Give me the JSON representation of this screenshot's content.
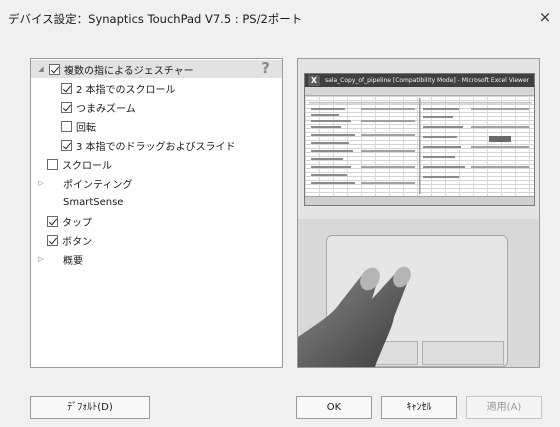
{
  "window": {
    "title": "デバイス設定：Synaptics TouchPad V7.5 : PS/2ポート",
    "close_glyph": "×"
  },
  "settings": {
    "help_glyph": "?",
    "items": [
      {
        "label": "複数の指によるジェスチャー",
        "checked": true
      },
      {
        "label": "2 本指でのスクロール",
        "checked": true
      },
      {
        "label": "つまみズーム",
        "checked": true
      },
      {
        "label": "回転",
        "checked": false
      },
      {
        "label": "3 本指でのドラッグおよびスライド",
        "checked": true
      },
      {
        "label": "スクロール",
        "checked": false
      },
      {
        "label": "ポインティング"
      },
      {
        "label": "SmartSense"
      },
      {
        "label": "タップ",
        "checked": true
      },
      {
        "label": "ボタン",
        "checked": true
      },
      {
        "label": "概要"
      }
    ]
  },
  "preview": {
    "excel_title": "sala_Copy_of_pipeline [Compatibility Mode] - Microsoft Excel Viewer",
    "excel_logo": "X"
  },
  "buttons": {
    "defaults": "ﾃﾞﾌｫﾙﾄ(D)",
    "ok": "OK",
    "cancel": "ｷｬﾝｾﾙ",
    "apply": "適用(A)"
  },
  "colors": {
    "dialog_bg": "#f0f0f0",
    "panel_bg": "#ffffff",
    "border": "#9a9a9a"
  }
}
